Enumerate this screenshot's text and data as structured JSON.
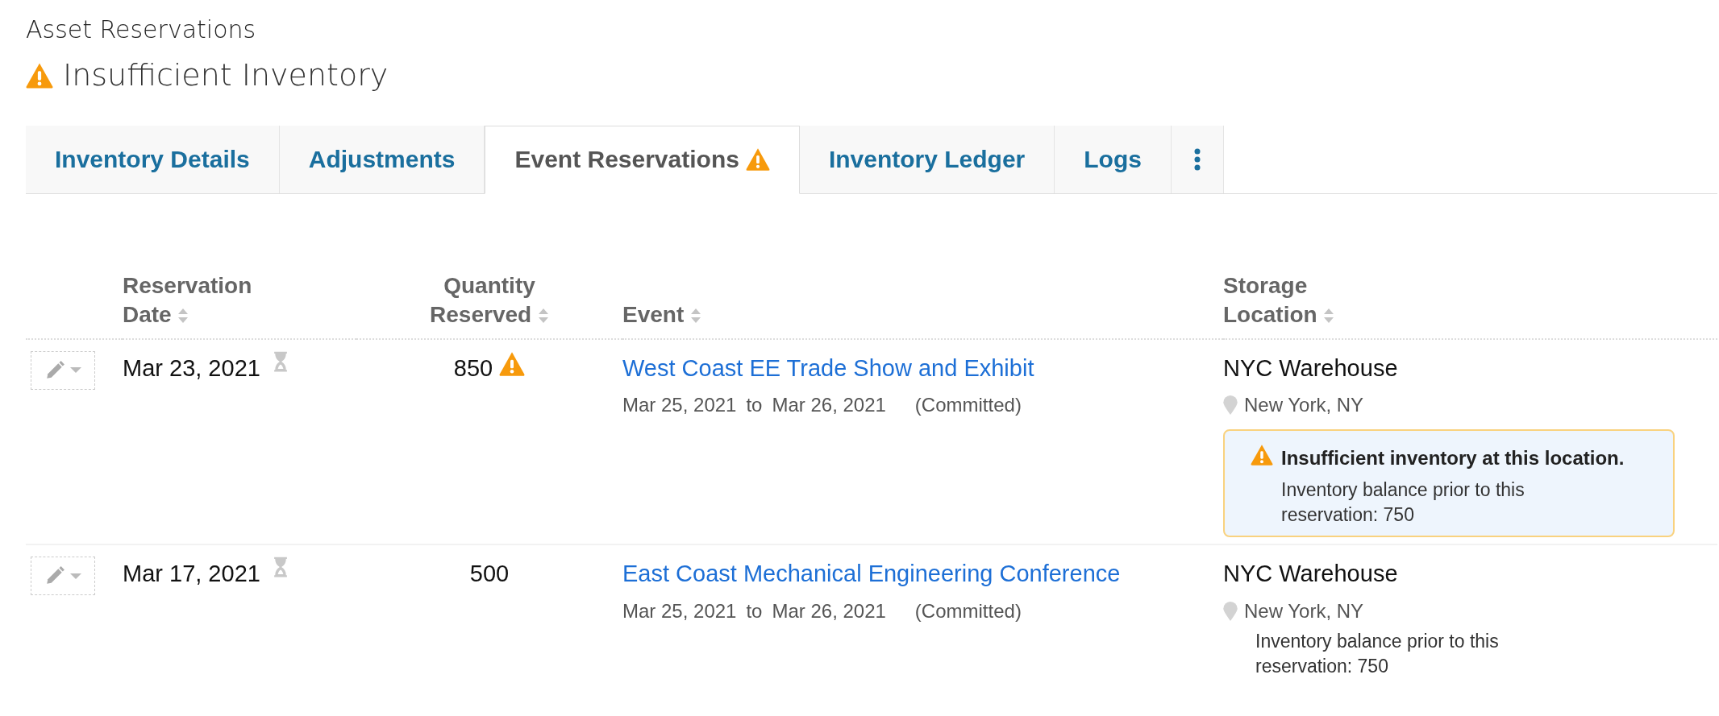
{
  "page": {
    "subtitle": "Asset Reservations",
    "title": "Insufficient Inventory",
    "title_warning": true
  },
  "tabs": [
    {
      "label": "Inventory Details",
      "selected": false,
      "warning": false,
      "kind": "text"
    },
    {
      "label": "Adjustments",
      "selected": false,
      "warning": false,
      "kind": "text"
    },
    {
      "label": "Event Reservations",
      "selected": true,
      "warning": true,
      "kind": "text"
    },
    {
      "label": "Inventory Ledger",
      "selected": false,
      "warning": false,
      "kind": "text"
    },
    {
      "label": "Logs",
      "selected": false,
      "warning": false,
      "kind": "text"
    },
    {
      "kind": "more",
      "selected": false,
      "warning": false
    }
  ],
  "table": {
    "columns": [
      {
        "label": "Reservation Date"
      },
      {
        "label": "Quantity Reserved"
      },
      {
        "label": "Event"
      },
      {
        "label": "Storage Location"
      }
    ],
    "rows": [
      {
        "date": "Mar 23, 2021",
        "quantity": "850",
        "quantity_warning": true,
        "event": "West Coast EE Trade Show and Exhibit",
        "start": "Mar 25, 2021",
        "to": "to",
        "end": "Mar 26, 2021",
        "status": "(Committed)",
        "location": "NYC Warehouse",
        "city": "New York, NY",
        "balance": {
          "warning": true,
          "title": "Insufficient inventory at this location.",
          "text": "Inventory balance prior to this reservation: 750"
        }
      },
      {
        "date": "Mar 17, 2021",
        "quantity": "500",
        "quantity_warning": false,
        "event": "East Coast Mechanical Engineering Conference",
        "start": "Mar 25, 2021",
        "to": "to",
        "end": "Mar 26, 2021",
        "status": "(Committed)",
        "location": "NYC Warehouse",
        "city": "New York, NY",
        "balance": {
          "warning": false,
          "text": "Inventory balance prior to this reservation: 750"
        }
      }
    ]
  }
}
